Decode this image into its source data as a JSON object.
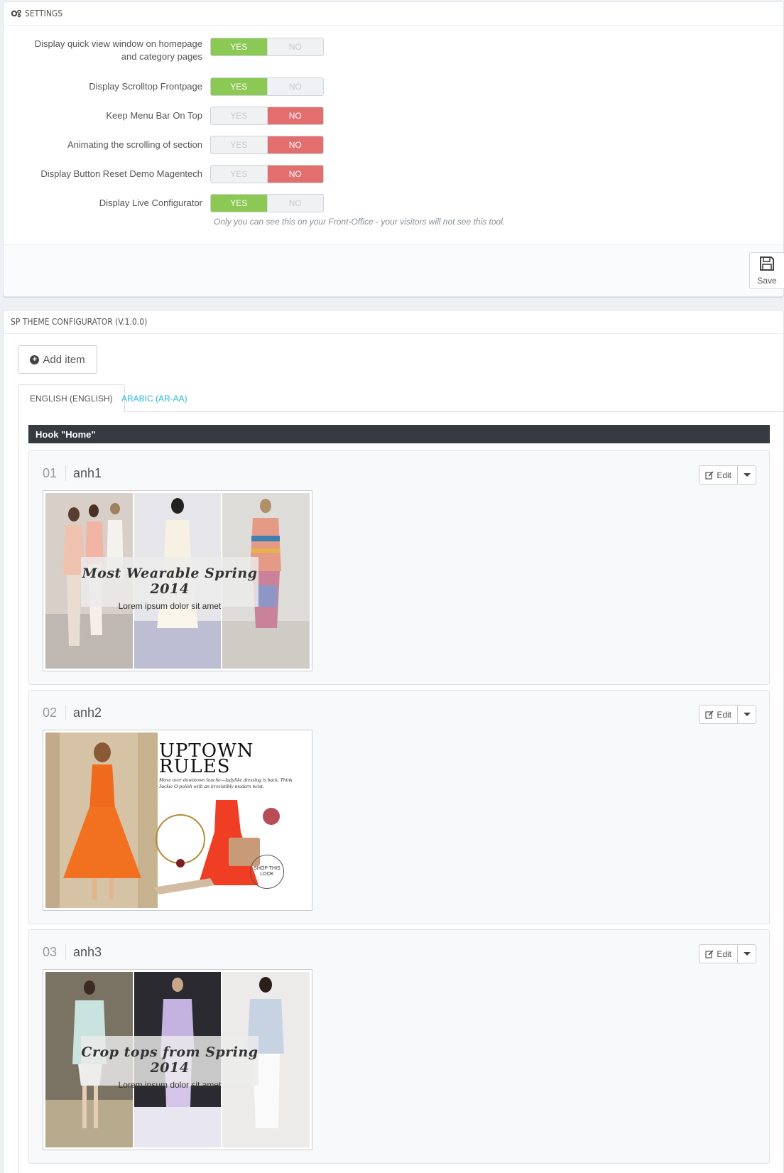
{
  "settings": {
    "title": "SETTINGS",
    "rows": [
      {
        "label": "Display quick view window on homepage and category pages",
        "yes": "YES",
        "no": "NO",
        "value": "yes"
      },
      {
        "label": "Display Scrolltop Frontpage",
        "yes": "YES",
        "no": "NO",
        "value": "yes"
      },
      {
        "label": "Keep Menu Bar On Top",
        "yes": "YES",
        "no": "NO",
        "value": "no"
      },
      {
        "label": "Animating the scrolling of section",
        "yes": "YES",
        "no": "NO",
        "value": "no"
      },
      {
        "label": "Display Button Reset Demo Magentech",
        "yes": "YES",
        "no": "NO",
        "value": "no"
      },
      {
        "label": "Display Live Configurator",
        "yes": "YES",
        "no": "NO",
        "value": "yes"
      }
    ],
    "help": "Only you can see this on your Front-Office - your visitors will not see this tool.",
    "save_label": "Save"
  },
  "configurator": {
    "title": "SP THEME CONFIGURATOR (V.1.0.0)",
    "add_label": "Add item",
    "tabs": [
      {
        "label": "ENGLISH (ENGLISH)",
        "active": true
      },
      {
        "label": "ARABIC (AR-AA)",
        "active": false
      }
    ],
    "hook_title": "Hook \"Home\"",
    "items": [
      {
        "num": "01",
        "title": "anh1",
        "edit": "Edit",
        "caption_title": "Most Wearable Spring 2014",
        "caption_sub": "Lorem ipsum dolor sit amet"
      },
      {
        "num": "02",
        "title": "anh2",
        "edit": "Edit",
        "mag_title": "UPTOWN RULES",
        "mag_sub": "Move over downtown louche—ladylike dressing is back. Think Jackie O polish with an irresistibly modern twist.",
        "shop": "SHOP THIS LOOK"
      },
      {
        "num": "03",
        "title": "anh3",
        "edit": "Edit",
        "caption_title": "Crop tops from Spring 2014",
        "caption_sub": "Lorem ipsum dolor sit amet"
      }
    ]
  },
  "colors": {
    "yes_on": "#8bc954",
    "no_on": "#e26e6e",
    "hook_bar": "#363a41",
    "tab_link": "#25b9d7"
  }
}
